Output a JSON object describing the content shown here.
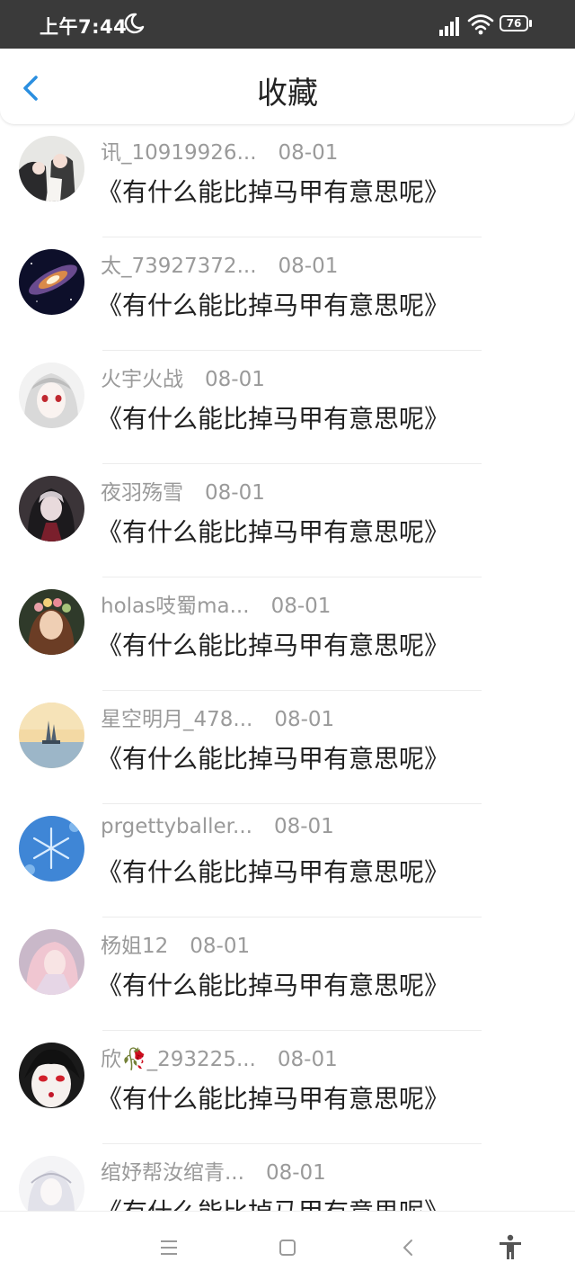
{
  "status_bar": {
    "time": "上午7:44",
    "battery": "76"
  },
  "header": {
    "title": "收藏"
  },
  "items": [
    {
      "name": "讯_10919926...",
      "date": "08-01",
      "title": "《有什么能比掉马甲有意思呢》",
      "avatar": "avatar-two-girls"
    },
    {
      "name": "太_73927372...",
      "date": "08-01",
      "title": "《有什么能比掉马甲有意思呢》",
      "avatar": "avatar-galaxy"
    },
    {
      "name": "火宇火战",
      "date": "08-01",
      "title": "《有什么能比掉马甲有意思呢》",
      "avatar": "avatar-anime-white-hair"
    },
    {
      "name": "夜羽殇雪",
      "date": "08-01",
      "title": "《有什么能比掉马甲有意思呢》",
      "avatar": "avatar-dark-anime"
    },
    {
      "name": "holas吱蜀ma...",
      "date": "08-01",
      "title": "《有什么能比掉马甲有意思呢》",
      "avatar": "avatar-flower-crown"
    },
    {
      "name": "星空明月_478...",
      "date": "08-01",
      "title": "《有什么能比掉马甲有意思呢》",
      "avatar": "avatar-ship-sunset"
    },
    {
      "name": "prgettyballer...",
      "date": "08-01",
      "title": "《有什么能比掉马甲有意思呢》",
      "avatar": "avatar-snowflake"
    },
    {
      "name": "杨姐12",
      "date": "08-01",
      "title": "《有什么能比掉马甲有意思呢》",
      "avatar": "avatar-pink-anime"
    },
    {
      "name": "欣🥀_293225...",
      "date": "08-01",
      "title": "《有什么能比掉马甲有意思呢》",
      "avatar": "avatar-red-eyes"
    },
    {
      "name": "绾妤帮汝绾青...",
      "date": "08-01",
      "title": "《有什么能比掉马甲有意思呢》",
      "avatar": "avatar-white-sketch"
    }
  ],
  "colors": {
    "accent": "#2b8fe0",
    "status_bar": "#3a3a3a",
    "meta_text": "#9a9a9a",
    "title_text": "#222222"
  }
}
